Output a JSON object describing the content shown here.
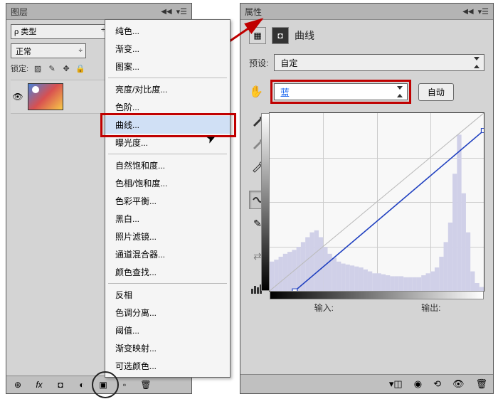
{
  "layers_panel": {
    "title": "图层",
    "filter_label": "类型",
    "blend_mode": "正常",
    "lock_label": "锁定:",
    "footer_icons": [
      "⊕",
      "fx",
      "◘",
      "◐",
      "▫",
      "▣",
      "🗑"
    ]
  },
  "adj_menu": {
    "groups": [
      [
        "纯色...",
        "渐变...",
        "图案..."
      ],
      [
        "亮度/对比度...",
        "色阶...",
        "曲线...",
        "曝光度..."
      ],
      [
        "自然饱和度...",
        "色相/饱和度...",
        "色彩平衡...",
        "黑白...",
        "照片滤镜...",
        "通道混合器...",
        "颜色查找..."
      ],
      [
        "反相",
        "色调分离...",
        "阈值...",
        "渐变映射...",
        "可选颜色..."
      ]
    ],
    "highlighted": "曲线..."
  },
  "props_panel": {
    "title": "属性",
    "adj_name": "曲线",
    "preset_label": "预设:",
    "preset_value": "自定",
    "channel_value": "蓝",
    "auto_label": "自动",
    "input_label": "输入:",
    "output_label": "输出:"
  },
  "chart_data": {
    "type": "line",
    "title": "",
    "xlabel": "输入",
    "ylabel": "输出",
    "xlim": [
      0,
      255
    ],
    "ylim": [
      0,
      255
    ],
    "series": [
      {
        "name": "curve",
        "points": [
          {
            "x": 30,
            "y": 0
          },
          {
            "x": 255,
            "y": 230
          }
        ]
      }
    ],
    "histogram_approx": [
      30,
      32,
      35,
      38,
      40,
      42,
      45,
      50,
      55,
      60,
      62,
      55,
      45,
      38,
      34,
      30,
      28,
      27,
      26,
      25,
      24,
      22,
      20,
      18,
      18,
      17,
      16,
      15,
      15,
      15,
      14,
      14,
      14,
      14,
      16,
      18,
      20,
      24,
      35,
      50,
      70,
      120,
      160,
      100,
      60,
      20,
      8,
      4
    ]
  }
}
